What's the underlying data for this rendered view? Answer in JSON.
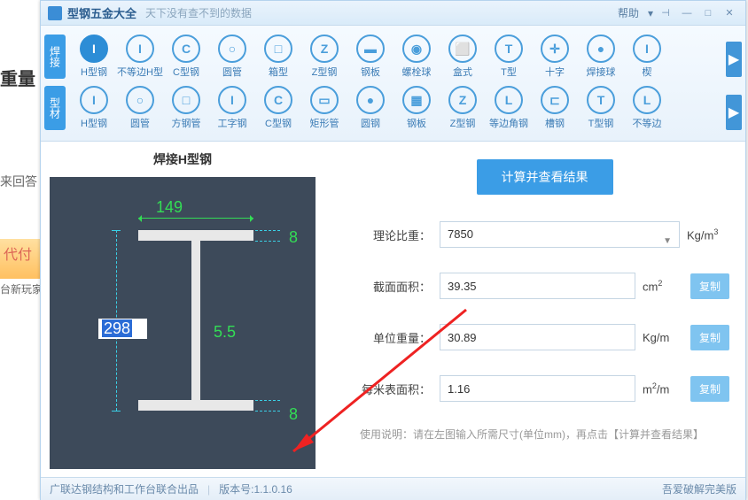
{
  "bg": {
    "t1": "重量",
    "t2": "来回答",
    "ad": "代付",
    "t3": "台新玩家"
  },
  "titlebar": {
    "title": "型钢五金大全",
    "subtitle": "天下没有查不到的数据",
    "help": "帮助"
  },
  "rows": {
    "r1": "焊接",
    "r2": "型材"
  },
  "row1": [
    {
      "icon": "I",
      "label": "H型钢",
      "active": true
    },
    {
      "icon": "I",
      "label": "不等边H型"
    },
    {
      "icon": "C",
      "label": "C型钢"
    },
    {
      "icon": "○",
      "label": "圆管"
    },
    {
      "icon": "□",
      "label": "箱型"
    },
    {
      "icon": "Z",
      "label": "Z型钢"
    },
    {
      "icon": "▬",
      "label": "钢板"
    },
    {
      "icon": "◉",
      "label": "螺栓球"
    },
    {
      "icon": "⬜",
      "label": "盒式"
    },
    {
      "icon": "T",
      "label": "T型"
    },
    {
      "icon": "✛",
      "label": "十字"
    },
    {
      "icon": "●",
      "label": "焊接球"
    },
    {
      "icon": "I",
      "label": "楔"
    }
  ],
  "row2": [
    {
      "icon": "I",
      "label": "H型钢"
    },
    {
      "icon": "○",
      "label": "圆管"
    },
    {
      "icon": "□",
      "label": "方钢管"
    },
    {
      "icon": "I",
      "label": "工字钢"
    },
    {
      "icon": "C",
      "label": "C型钢"
    },
    {
      "icon": "▭",
      "label": "矩形管"
    },
    {
      "icon": "●",
      "label": "圆钢"
    },
    {
      "icon": "▦",
      "label": "钢板"
    },
    {
      "icon": "Z",
      "label": "Z型钢"
    },
    {
      "icon": "L",
      "label": "等边角钢"
    },
    {
      "icon": "⊏",
      "label": "槽钢"
    },
    {
      "icon": "T",
      "label": "T型钢"
    },
    {
      "icon": "L",
      "label": "不等边"
    }
  ],
  "diagram": {
    "title": "焊接H型钢",
    "width": "149",
    "height": "298",
    "web": "5.5",
    "flange1": "8",
    "flange2": "8"
  },
  "form": {
    "calc": "计算并查看结果",
    "f1_label": "理论比重：",
    "f1_val": "7850",
    "f1_unit": "Kg/m³",
    "f2_label": "截面面积：",
    "f2_val": "39.35",
    "f2_unit": "cm²",
    "f3_label": "单位重量：",
    "f3_val": "30.89",
    "f3_unit": "Kg/m",
    "f4_label": "每米表面积：",
    "f4_val": "1.16",
    "f4_unit": "m²/m",
    "copy": "复制",
    "hint": "使用说明：请在左图输入所需尺寸(单位mm)，再点击【计算并查看结果】"
  },
  "status": {
    "left": "广联达钢结构和工作台联合出品",
    "ver": "版本号:1.1.0.16",
    "right": "吾爱破解完美版"
  }
}
